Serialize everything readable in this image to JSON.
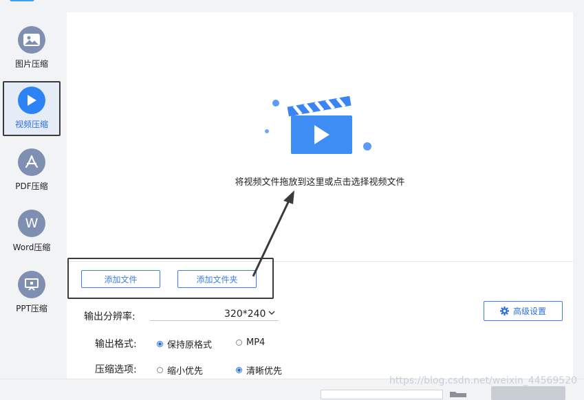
{
  "sidebar": {
    "items": [
      {
        "label": "图片压缩",
        "icon": "image-icon",
        "active": false
      },
      {
        "label": "视频压缩",
        "icon": "play-icon",
        "active": true
      },
      {
        "label": "PDF压缩",
        "icon": "pdf-icon",
        "active": false
      },
      {
        "label": "Word压缩",
        "icon": "word-icon",
        "active": false
      },
      {
        "label": "PPT压缩",
        "icon": "ppt-icon",
        "active": false
      }
    ]
  },
  "dropzone": {
    "hint": "将视频文件拖放到这里或点击选择视频文件",
    "icon": "video-clapper-icon"
  },
  "buttons": {
    "add_file": "添加文件",
    "add_folder": "添加文件夹",
    "advanced": "高级设置"
  },
  "settings": {
    "resolution_label": "输出分辨率:",
    "resolution_value": "320*240",
    "format_label": "输出格式:",
    "format_options": [
      "保持原格式",
      "MP4"
    ],
    "format_selected": "保持原格式",
    "compress_label": "压缩选项:",
    "compress_options": [
      "缩小优先",
      "清晰优先"
    ],
    "compress_selected": "清晰优先"
  },
  "watermark": "https://blog.csdn.net/weixin_44569520",
  "colors": {
    "accent": "#2b83f6",
    "inactive_icon": "#7f8fb2",
    "highlight_border": "#3a3a3a"
  }
}
